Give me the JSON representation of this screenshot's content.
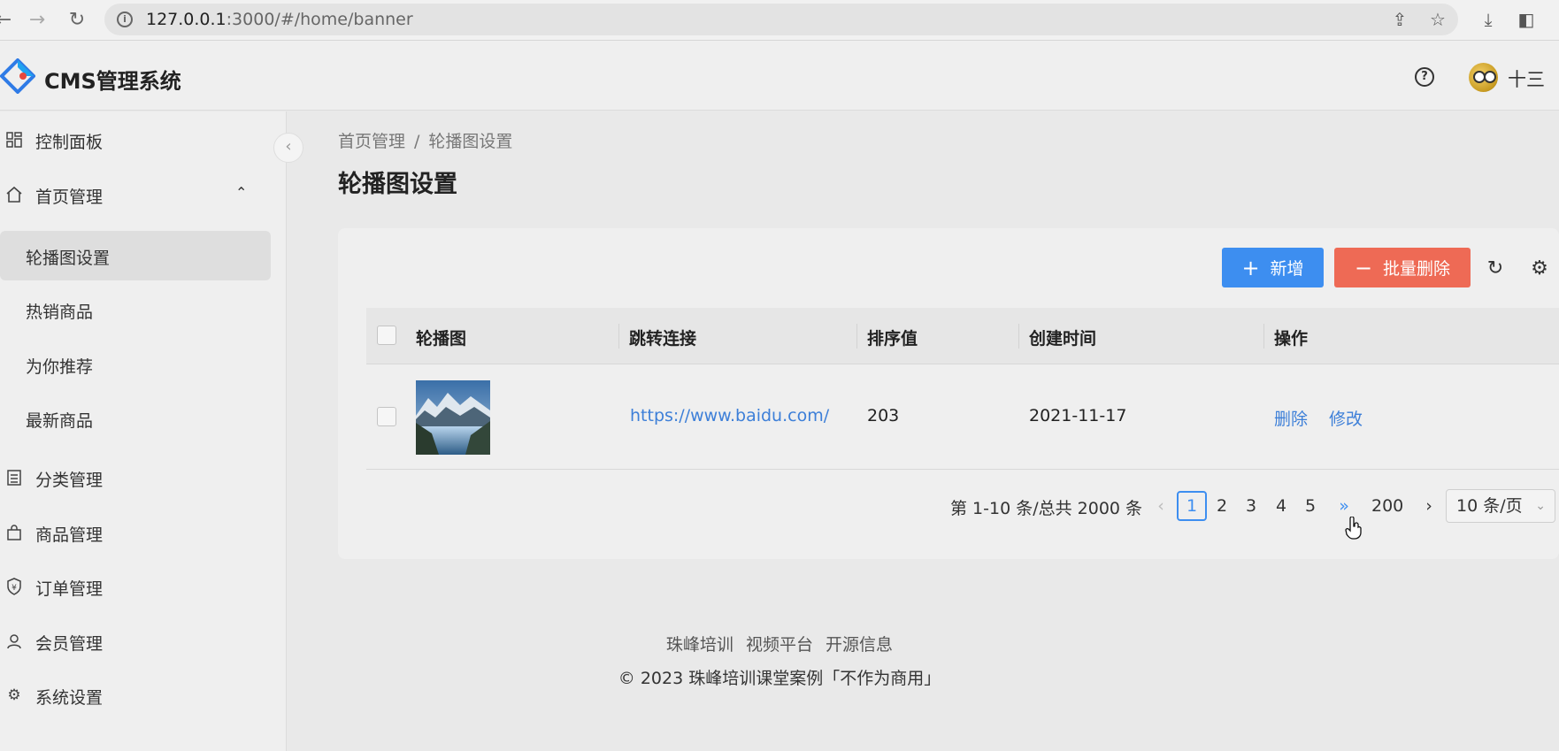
{
  "browser": {
    "url_host": "127.0.0.1",
    "url_rest": ":3000/#/home/banner"
  },
  "app": {
    "title": "CMS管理系统",
    "username": "十三"
  },
  "sidebar": {
    "items": [
      {
        "label": "控制面板",
        "icon": "dashboard-icon"
      },
      {
        "label": "首页管理",
        "icon": "home-icon"
      },
      {
        "label": "分类管理",
        "icon": "category-icon"
      },
      {
        "label": "商品管理",
        "icon": "shopping-bag-icon"
      },
      {
        "label": "订单管理",
        "icon": "order-shield-icon"
      },
      {
        "label": "会员管理",
        "icon": "user-icon"
      },
      {
        "label": "系统设置",
        "icon": "gear-icon"
      }
    ],
    "sub_items": [
      "轮播图设置",
      "热销商品",
      "为你推荐",
      "最新商品"
    ]
  },
  "breadcrumb": {
    "root": "首页管理",
    "separator": "/",
    "current": "轮播图设置"
  },
  "page_title": "轮播图设置",
  "toolbar": {
    "add_label": "新增",
    "batch_delete_label": "批量删除"
  },
  "table": {
    "columns": [
      "轮播图",
      "跳转连接",
      "排序值",
      "创建时间",
      "操作"
    ],
    "rows": [
      {
        "link": "https://www.baidu.com/",
        "sort": "203",
        "created": "2021-11-17",
        "actions": [
          "删除",
          "修改"
        ]
      }
    ]
  },
  "pagination": {
    "summary": "第 1-10 条/总共 2000 条",
    "pages": [
      "1",
      "2",
      "3",
      "4",
      "5"
    ],
    "last_page": "200",
    "page_size": "10 条/页",
    "current": "1"
  },
  "footer": {
    "links": [
      "珠峰培训",
      "视频平台",
      "开源信息"
    ],
    "copyright": "© 2023 珠峰培训课堂案例「不作为商用」"
  },
  "colors": {
    "primary": "#3d8ef0",
    "danger": "#ee6a55",
    "link": "#3d7fd8"
  }
}
